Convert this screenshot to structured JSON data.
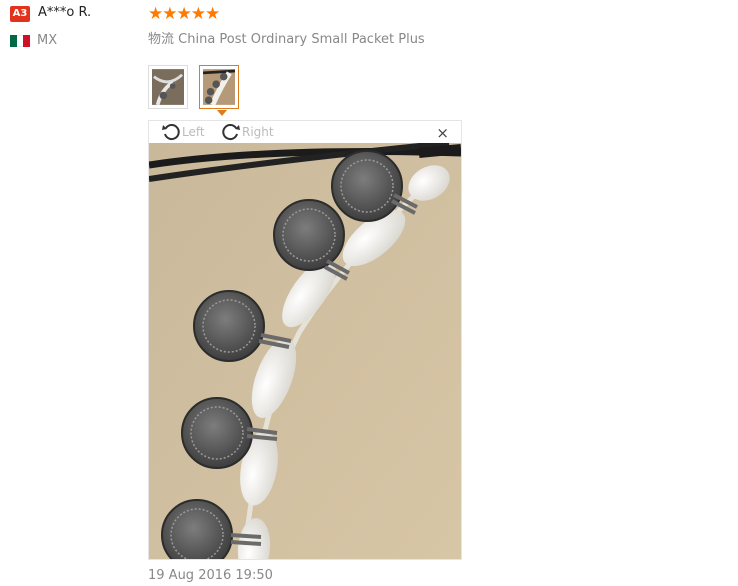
{
  "review": {
    "avatar_badge": "A3",
    "user_name": "A***o R.",
    "country": "MX",
    "flag_colors": [
      "#006847",
      "#ffffff",
      "#ce1126"
    ],
    "rating": 5,
    "stars": "★★★★★",
    "star_color": "#ff7a00",
    "shipping_label": "物流",
    "shipping_method": "China Post Ordinary Small Packet Plus",
    "timestamp": "19 Aug 2016 19:50"
  },
  "viewer": {
    "rotate_left_label": "Left",
    "rotate_right_label": "Right",
    "close_glyph": "×",
    "selected_thumbnail": 2,
    "accent": "#e07b1b"
  },
  "icons": [
    "rotate-left-icon",
    "rotate-right-icon",
    "close-icon",
    "flag-icon",
    "star-icon"
  ]
}
